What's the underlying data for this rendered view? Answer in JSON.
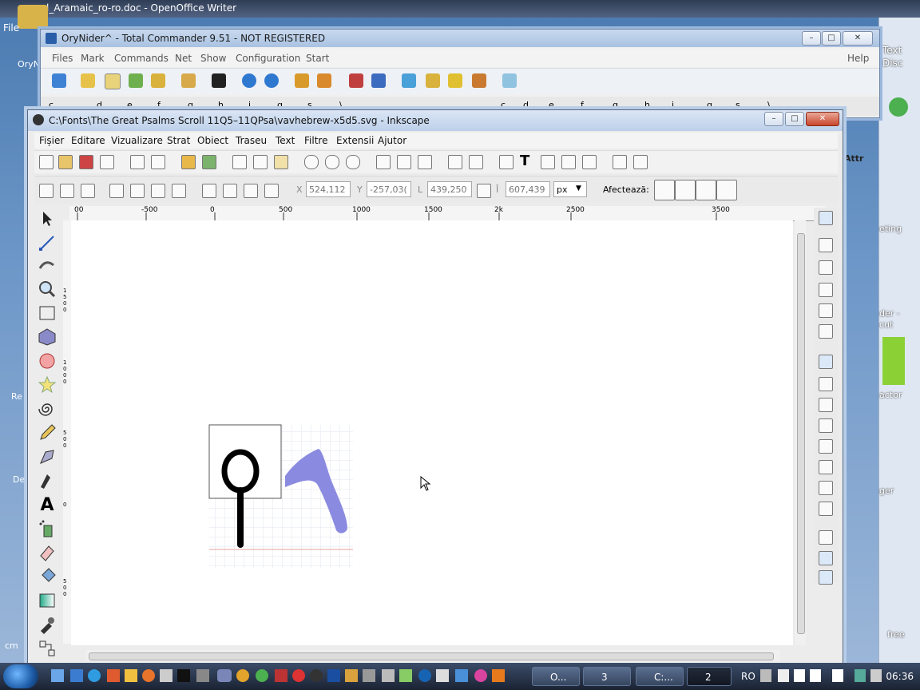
{
  "desktop": {
    "top_doc_title": "l_Aramaic_ro-ro.doc - OpenOffice Writer",
    "left_labels": [
      "File",
      "OryN",
      "Re",
      "De",
      "cm"
    ],
    "right_labels": [
      "Text",
      "Disc",
      "Attr",
      "eting",
      "der -",
      "cut",
      "actor",
      "ger",
      "free"
    ]
  },
  "total_commander": {
    "title": "OryNider^ - Total Commander 9.51 - NOT REGISTERED",
    "menu": [
      "Files",
      "Mark",
      "Commands",
      "Net",
      "Show",
      "Configuration",
      "Start"
    ],
    "help": "Help",
    "drives_left": [
      "c",
      "d",
      "e",
      "f",
      "g",
      "h",
      "i",
      "q",
      "s",
      "\\"
    ],
    "drives_right": [
      "c",
      "d",
      "e",
      "f",
      "g",
      "h",
      "i",
      "q",
      "s",
      "\\"
    ]
  },
  "inkscape": {
    "title": "C:\\Fonts\\The Great Psalms Scroll 11Q5–11QPsa\\vavhebrew-x5d5.svg - Inkscape",
    "menu": [
      "Fișier",
      "Editare",
      "Vizualizare",
      "Strat",
      "Obiect",
      "Traseu",
      "Text",
      "Filtre",
      "Extensii",
      "Ajutor"
    ],
    "coords": {
      "x_label": "X",
      "x_value": "524,112",
      "y_label": "Y",
      "y_value": "-257,03(",
      "w_label": "L",
      "w_value": "439,250",
      "h_label": "Î",
      "h_value": "607,439",
      "unit": "px",
      "affects_label": "Afectează:"
    },
    "ruler_h_labels": [
      "00",
      "-500",
      "0",
      "500",
      "1000",
      "1500",
      "2k",
      "2500",
      "3500"
    ],
    "ruler_v_labels": [
      "1500",
      "1000",
      "500",
      "0",
      "500"
    ]
  },
  "taskbar": {
    "buttons": [
      "O...",
      "3",
      "C:...",
      "2"
    ],
    "lang": "RO",
    "clock": "06:36"
  },
  "colors": {
    "glyph_stroke": "#000000",
    "shadow_shape": "#8a8ae0",
    "grid": "#dfe6ec",
    "baseline": "#e7a0a0"
  }
}
